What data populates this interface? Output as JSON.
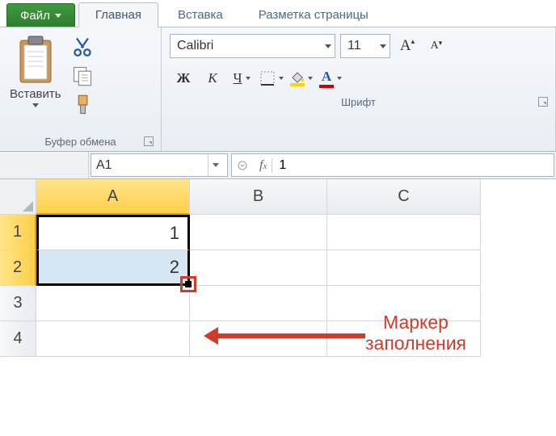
{
  "tabs": {
    "file": "Файл",
    "home": "Главная",
    "insert": "Вставка",
    "layout": "Разметка страницы"
  },
  "ribbon": {
    "clipboard": {
      "paste": "Вставить",
      "title": "Буфер обмена"
    },
    "font": {
      "name": "Calibri",
      "size": "11",
      "bold": "Ж",
      "italic": "К",
      "underline": "Ч",
      "title": "Шрифт"
    }
  },
  "namebox": "A1",
  "formula": "1",
  "grid": {
    "columns": [
      "A",
      "B",
      "C"
    ],
    "rows": [
      "1",
      "2",
      "3",
      "4"
    ],
    "cells": {
      "a1": "1",
      "a2": "2"
    }
  },
  "callout": {
    "line1": "Маркер",
    "line2": "заполнения"
  }
}
